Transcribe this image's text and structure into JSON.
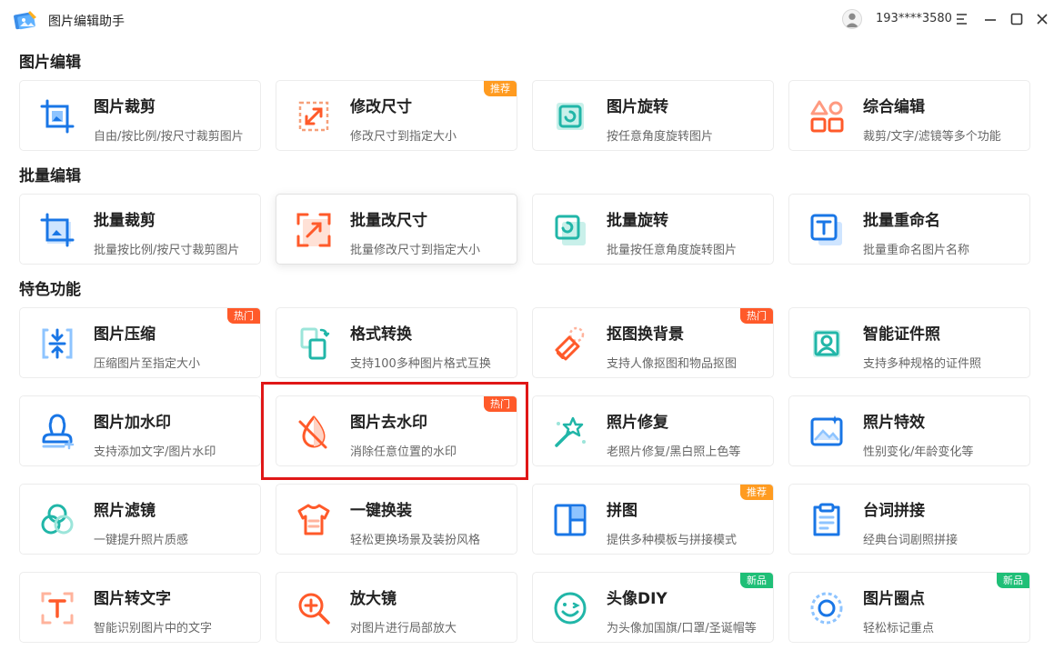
{
  "app": {
    "title": "图片编辑助手",
    "account": "193****3580"
  },
  "sections": [
    {
      "title": "图片编辑",
      "items": [
        {
          "title": "图片裁剪",
          "subtitle": "自由/按比例/按尺寸裁剪图片",
          "badge": "",
          "icon": "crop-icon"
        },
        {
          "title": "修改尺寸",
          "subtitle": "修改尺寸到指定大小",
          "badge": "推荐",
          "icon": "resize-icon"
        },
        {
          "title": "图片旋转",
          "subtitle": "按任意角度旋转图片",
          "badge": "",
          "icon": "rotate-icon"
        },
        {
          "title": "综合编辑",
          "subtitle": "裁剪/文字/滤镜等多个功能",
          "badge": "",
          "icon": "shapes-icon"
        }
      ]
    },
    {
      "title": "批量编辑",
      "items": [
        {
          "title": "批量裁剪",
          "subtitle": "批量按比例/按尺寸裁剪图片",
          "badge": "",
          "icon": "batch-crop-icon"
        },
        {
          "title": "批量改尺寸",
          "subtitle": "批量修改尺寸到指定大小",
          "badge": "",
          "icon": "batch-resize-icon"
        },
        {
          "title": "批量旋转",
          "subtitle": "批量按任意角度旋转图片",
          "badge": "",
          "icon": "batch-rotate-icon"
        },
        {
          "title": "批量重命名",
          "subtitle": "批量重命名图片名称",
          "badge": "",
          "icon": "rename-icon"
        }
      ]
    },
    {
      "title": "特色功能",
      "items": [
        {
          "title": "图片压缩",
          "subtitle": "压缩图片至指定大小",
          "badge": "热门",
          "icon": "compress-icon"
        },
        {
          "title": "格式转换",
          "subtitle": "支持100多种图片格式互换",
          "badge": "",
          "icon": "convert-icon"
        },
        {
          "title": "抠图换背景",
          "subtitle": "支持人像抠图和物品抠图",
          "badge": "热门",
          "icon": "eraser-icon"
        },
        {
          "title": "智能证件照",
          "subtitle": "支持多种规格的证件照",
          "badge": "",
          "icon": "id-photo-icon"
        },
        {
          "title": "图片加水印",
          "subtitle": "支持添加文字/图片水印",
          "badge": "",
          "icon": "stamp-icon"
        },
        {
          "title": "图片去水印",
          "subtitle": "消除任意位置的水印",
          "badge": "热门",
          "icon": "drop-slash-icon"
        },
        {
          "title": "照片修复",
          "subtitle": "老照片修复/黑白照上色等",
          "badge": "",
          "icon": "magic-wand-icon"
        },
        {
          "title": "照片特效",
          "subtitle": "性别变化/年龄变化等",
          "badge": "",
          "icon": "image-effect-icon"
        },
        {
          "title": "照片滤镜",
          "subtitle": "一键提升照片质感",
          "badge": "",
          "icon": "filter-icon"
        },
        {
          "title": "一键换装",
          "subtitle": "轻松更换场景及装扮风格",
          "badge": "",
          "icon": "shirt-icon"
        },
        {
          "title": "拼图",
          "subtitle": "提供多种模板与拼接模式",
          "badge": "推荐",
          "icon": "collage-icon"
        },
        {
          "title": "台词拼接",
          "subtitle": "经典台词剧照拼接",
          "badge": "",
          "icon": "clipboard-icon"
        },
        {
          "title": "图片转文字",
          "subtitle": "智能识别图片中的文字",
          "badge": "",
          "icon": "ocr-icon"
        },
        {
          "title": "放大镜",
          "subtitle": "对图片进行局部放大",
          "badge": "",
          "icon": "magnifier-icon"
        },
        {
          "title": "头像DIY",
          "subtitle": "为头像加国旗/口罩/圣诞帽等",
          "badge": "新品",
          "icon": "smiley-icon"
        },
        {
          "title": "图片圈点",
          "subtitle": "轻松标记重点",
          "badge": "新品",
          "icon": "circle-mark-icon"
        }
      ]
    }
  ],
  "colors": {
    "blue": "#1976e6",
    "orange": "#ff5a2a",
    "teal": "#21b6a8",
    "highlight": "#e01717"
  }
}
